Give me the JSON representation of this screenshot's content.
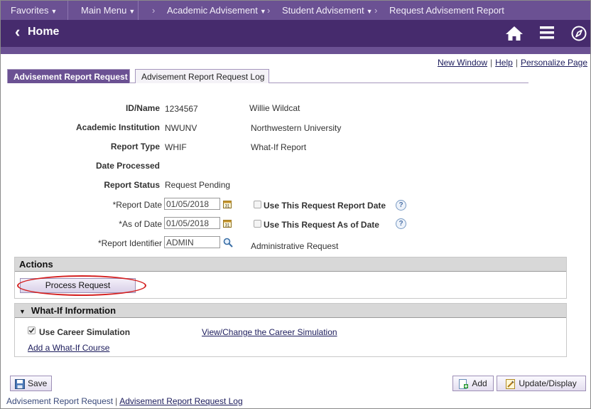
{
  "topbar": {
    "favorites": "Favorites",
    "main_menu": "Main Menu",
    "breadcrumb_1": "Academic Advisement",
    "breadcrumb_2": "Student Advisement",
    "breadcrumb_3": "Request Advisement Report"
  },
  "homebar": {
    "title": "Home"
  },
  "toplinks": {
    "new_window": "New Window",
    "help": "Help",
    "personalize": "Personalize Page"
  },
  "tabs": [
    {
      "label": "Advisement Report Request",
      "active": true
    },
    {
      "label": "Advisement Report Request Log",
      "active": false
    }
  ],
  "form": {
    "id_name_label": "ID/Name",
    "id_value": "1234567",
    "name_value": "Willie Wildcat",
    "institution_label": "Academic Institution",
    "institution_code": "NWUNV",
    "institution_name": "Northwestern University",
    "report_type_label": "Report Type",
    "report_type_code": "WHIF",
    "report_type_name": "What-If Report",
    "date_processed_label": "Date Processed",
    "report_status_label": "Report Status",
    "report_status_value": "Request Pending",
    "report_date_label": "*Report Date",
    "report_date_value": "01/05/2018",
    "use_report_date_label": "Use This Request Report Date",
    "as_of_date_label": "*As of Date",
    "as_of_date_value": "01/05/2018",
    "use_as_of_date_label": "Use This Request As of Date",
    "report_identifier_label": "*Report Identifier",
    "report_identifier_value": "ADMIN",
    "report_identifier_desc": "Administrative Request"
  },
  "actions": {
    "header": "Actions",
    "process_button": "Process Request"
  },
  "whatif": {
    "header": "What-If Information",
    "use_career_sim_label": "Use Career Simulation",
    "use_career_sim_checked": true,
    "view_change_link": "View/Change the Career Simulation",
    "add_course_link": "Add a What-If Course"
  },
  "buttons": {
    "save": "Save",
    "add": "Add",
    "update_display": "Update/Display"
  },
  "bottomlinks": {
    "request": "Advisement Report Request",
    "log": "Advisement Report Request Log"
  },
  "colors": {
    "topbar": "#6b5193",
    "homebar": "#462b6d",
    "highlight_oval": "#d42020"
  }
}
